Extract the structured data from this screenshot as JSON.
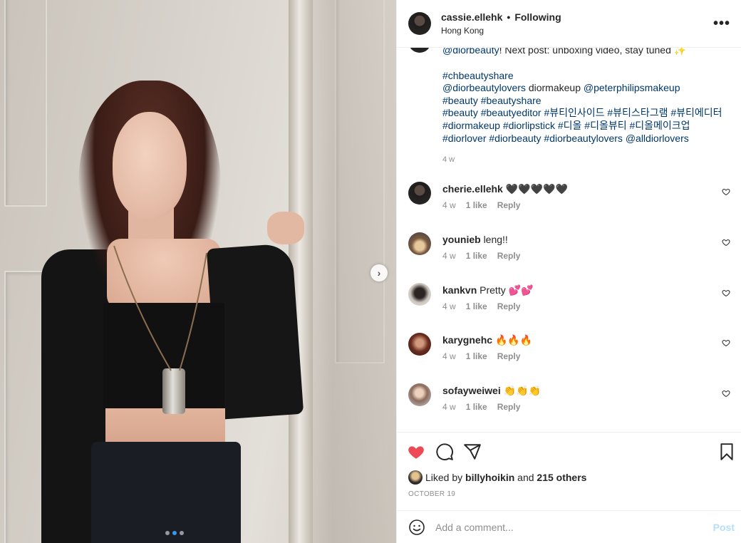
{
  "post": {
    "username": "cassie.ellehk",
    "separator": "•",
    "follow_status": "Following",
    "location": "Hong Kong",
    "more_icon": "more-options-icon",
    "more_label": "•••"
  },
  "photo": {
    "next_arrow": "›",
    "carousel_dots": 3,
    "active_dot": 2
  },
  "caption": {
    "line1_mention": "@diorbeauty",
    "line1_rest": "! Next post: unboxing video, stay tuned ✨",
    "tags": [
      "#chbeautyshare",
      "@diorbeautylovers diormakeup @peterphilipsmakeup",
      "#beauty #beautyshare",
      "#beauty #beautyeditor #뷰티인사이드 #뷰티스타그램 #뷰티에디터",
      "#diormakeup #diorlipstick #디올 #디올뷰티 #디올메이크업",
      "#diorlover #diorbeauty #diorbeautylovers @alldiorlovers"
    ],
    "time": "4 w"
  },
  "comments": [
    {
      "user": "cherie.ellehk",
      "text": "🖤🖤🖤🖤🖤",
      "time": "4 w",
      "likes": "1 like",
      "reply": "Reply"
    },
    {
      "user": "younieb",
      "text": "leng!!",
      "time": "4 w",
      "likes": "1 like",
      "reply": "Reply"
    },
    {
      "user": "kankvn",
      "text": "Pretty 💕💕",
      "time": "4 w",
      "likes": "1 like",
      "reply": "Reply"
    },
    {
      "user": "karygnehc",
      "text": "🔥🔥🔥",
      "time": "4 w",
      "likes": "1 like",
      "reply": "Reply"
    },
    {
      "user": "sofayweiwei",
      "text": "👏👏👏",
      "time": "4 w",
      "likes": "1 like",
      "reply": "Reply"
    }
  ],
  "likes": {
    "prefix": "Liked by",
    "user": "billyhoikin",
    "and": "and",
    "others": "215 others"
  },
  "date": "OCTOBER 19",
  "add_comment": {
    "placeholder": "Add a comment...",
    "post_label": "Post"
  },
  "colors": {
    "link": "#00376b",
    "like_red": "#ed4956",
    "post_disabled": "#b2dffc",
    "carousel_active": "#3897f0"
  }
}
